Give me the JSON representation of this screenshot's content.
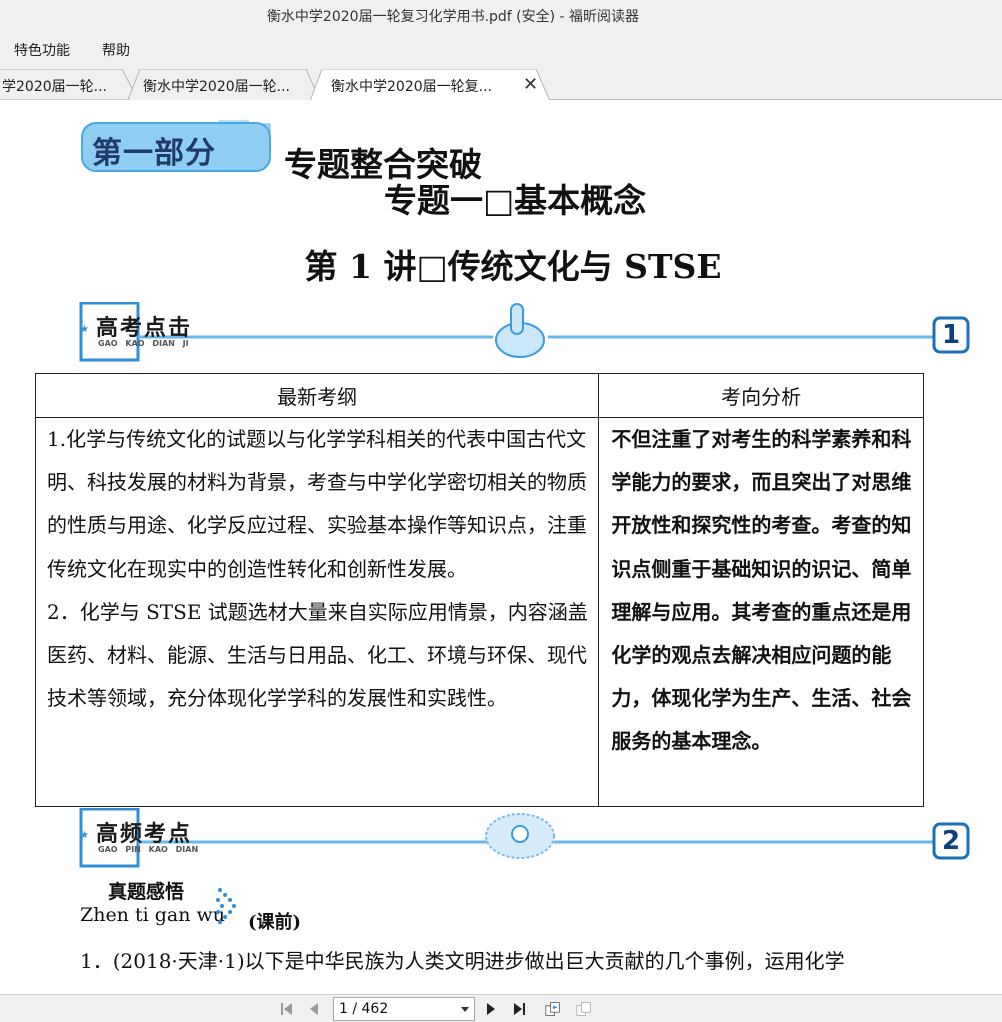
{
  "window": {
    "title": "衡水中学2020届一轮复习化学用书.pdf (安全) - 福昕阅读器"
  },
  "menu": {
    "items": [
      "特色功能",
      "帮助"
    ]
  },
  "tabs": [
    {
      "label": "学2020届一轮...",
      "active": false
    },
    {
      "label": "衡水中学2020届一轮...",
      "active": false
    },
    {
      "label": "衡水中学2020届一轮复...",
      "active": true
    }
  ],
  "document": {
    "part_badge": "第一部分",
    "heading1": "专题整合突破",
    "heading2": "专题一□基本概念",
    "heading3": "第 1 讲□传统文化与 STSE",
    "section1": {
      "title": "高考点击",
      "pinyin": "GAO KAO DIAN JI",
      "number": "1"
    },
    "table": {
      "headers": [
        "最新考纲",
        "考向分析"
      ],
      "left_paragraphs": [
        "1.化学与传统文化的试题以与化学学科相关的代表中国古代文明、科技发展的材料为背景，考查与中学化学密切相关的物质的性质与用途、化学反应过程、实验基本操作等知识点，注重传统文化在现实中的创造性转化和创新性发展。",
        "2．化学与 STSE 试题选材大量来自实际应用情景，内容涵盖医药、材料、能源、生活与日用品、化工、环境与环保、现代技术等领域，充分体现化学学科的发展性和实践性。"
      ],
      "right_text": "不但注重了对考生的科学素养和科学能力的要求，而且突出了对思维开放性和探究性的考查。考查的知识点侧重于基础知识的识记、简单理解与应用。其考查的重点还是用化学的观点去解决相应问题的能力，体现化学为生产、生活、社会服务的基本理念。"
    },
    "section2": {
      "title": "高频考点",
      "pinyin": "GAO PIN KAO DIAN",
      "number": "2"
    },
    "zhenti": {
      "title": "真题感悟",
      "pinyin": "Zhen ti gan wu",
      "tag": "(课前)"
    },
    "question": "1．(2018·天津·1)以下是中华民族为人类文明进步做出巨大贡献的几个事例，运用化学"
  },
  "navigation": {
    "page_display": "1 / 462",
    "current_page": 1,
    "total_pages": 462
  },
  "colors": {
    "accent_blue": "#4aa8e4",
    "badge_blue": "#8fcdf2",
    "chrome_bg": "#f0f0f0"
  },
  "icons": [
    "first-page-icon",
    "prev-page-icon",
    "next-page-icon",
    "last-page-icon",
    "prev-view-icon",
    "next-view-icon",
    "close-icon"
  ]
}
